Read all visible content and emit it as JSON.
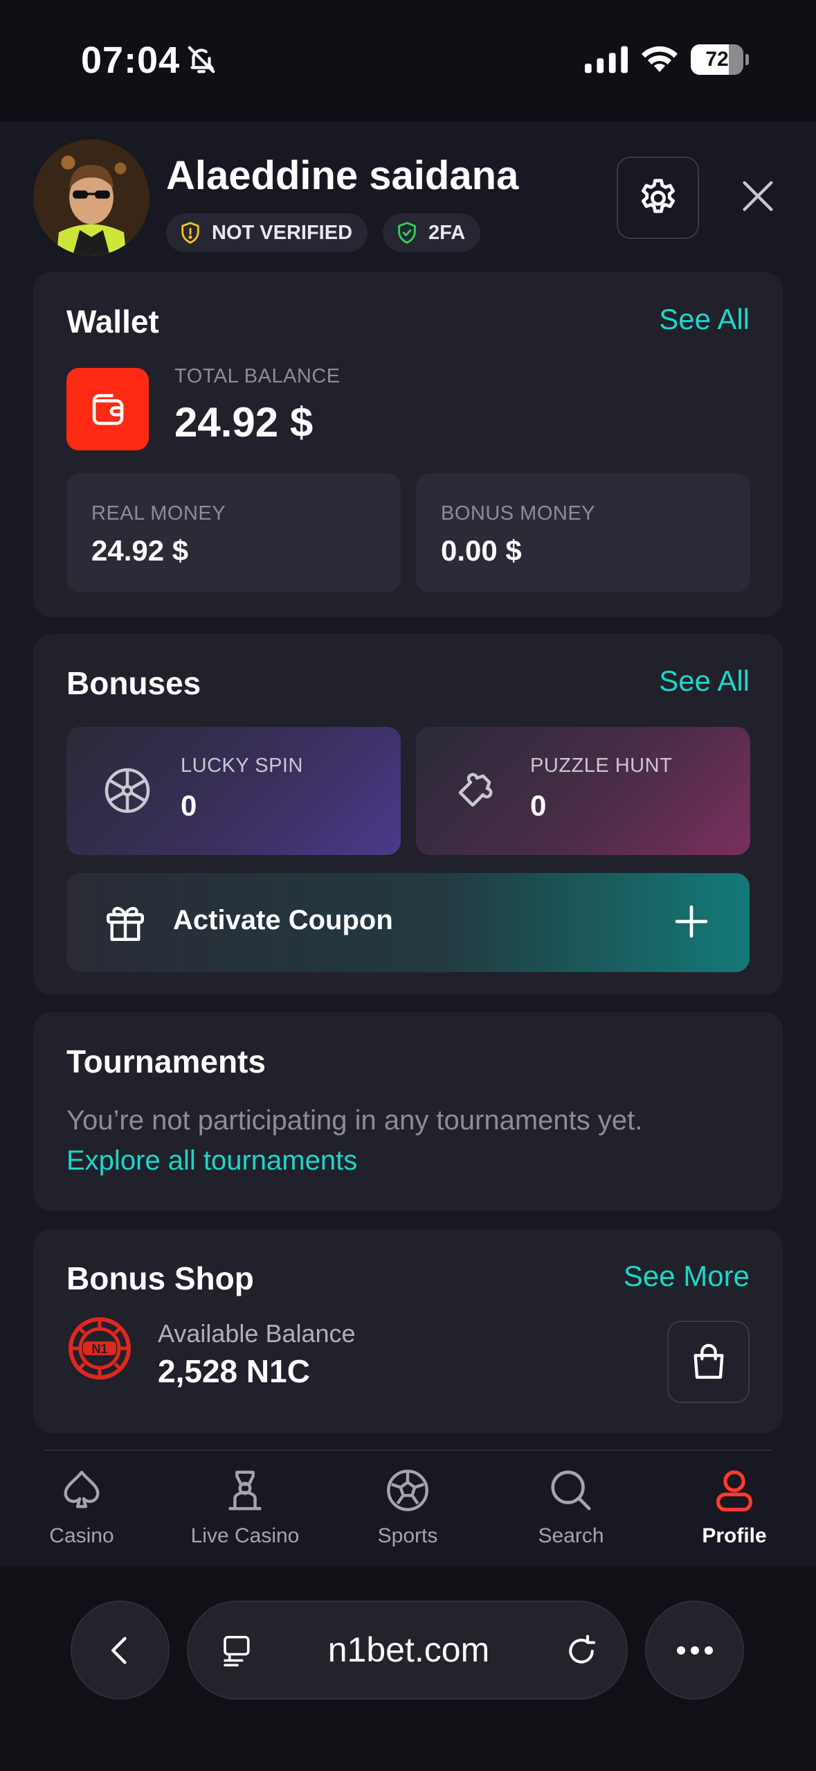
{
  "status_bar": {
    "time": "07:04",
    "battery": "72",
    "battery_level": 0.72
  },
  "profile": {
    "name": "Alaeddine saidana",
    "badge_verify": "NOT VERIFIED",
    "badge_2fa": "2FA"
  },
  "wallet": {
    "title": "Wallet",
    "see_all": "See All",
    "total_label": "TOTAL BALANCE",
    "total_value": "24.92 $",
    "real_label": "REAL MONEY",
    "real_value": "24.92 $",
    "bonus_label": "BONUS MONEY",
    "bonus_value": "0.00 $"
  },
  "bonuses": {
    "title": "Bonuses",
    "see_all": "See All",
    "lucky_label": "LUCKY SPIN",
    "lucky_value": "0",
    "puzzle_label": "PUZZLE HUNT",
    "puzzle_value": "0",
    "coupon_label": "Activate Coupon"
  },
  "tournaments": {
    "title": "Tournaments",
    "empty_text": "You’re not participating in any tournaments yet.",
    "explore_link": "Explore all tournaments"
  },
  "bonus_shop": {
    "title": "Bonus Shop",
    "see_more": "See More",
    "balance_label": "Available Balance",
    "balance_value": "2,528 N1C",
    "coin_text": "N1"
  },
  "bottom_nav": {
    "casino": "Casino",
    "live_casino": "Live Casino",
    "sports": "Sports",
    "search": "Search",
    "profile": "Profile"
  },
  "browser": {
    "url": "n1bet.com"
  },
  "colors": {
    "accent": "#1ed6c8",
    "wallet_red": "#ff2a14",
    "profile_active": "#ff3b2f",
    "card_bg": "#20212b"
  }
}
